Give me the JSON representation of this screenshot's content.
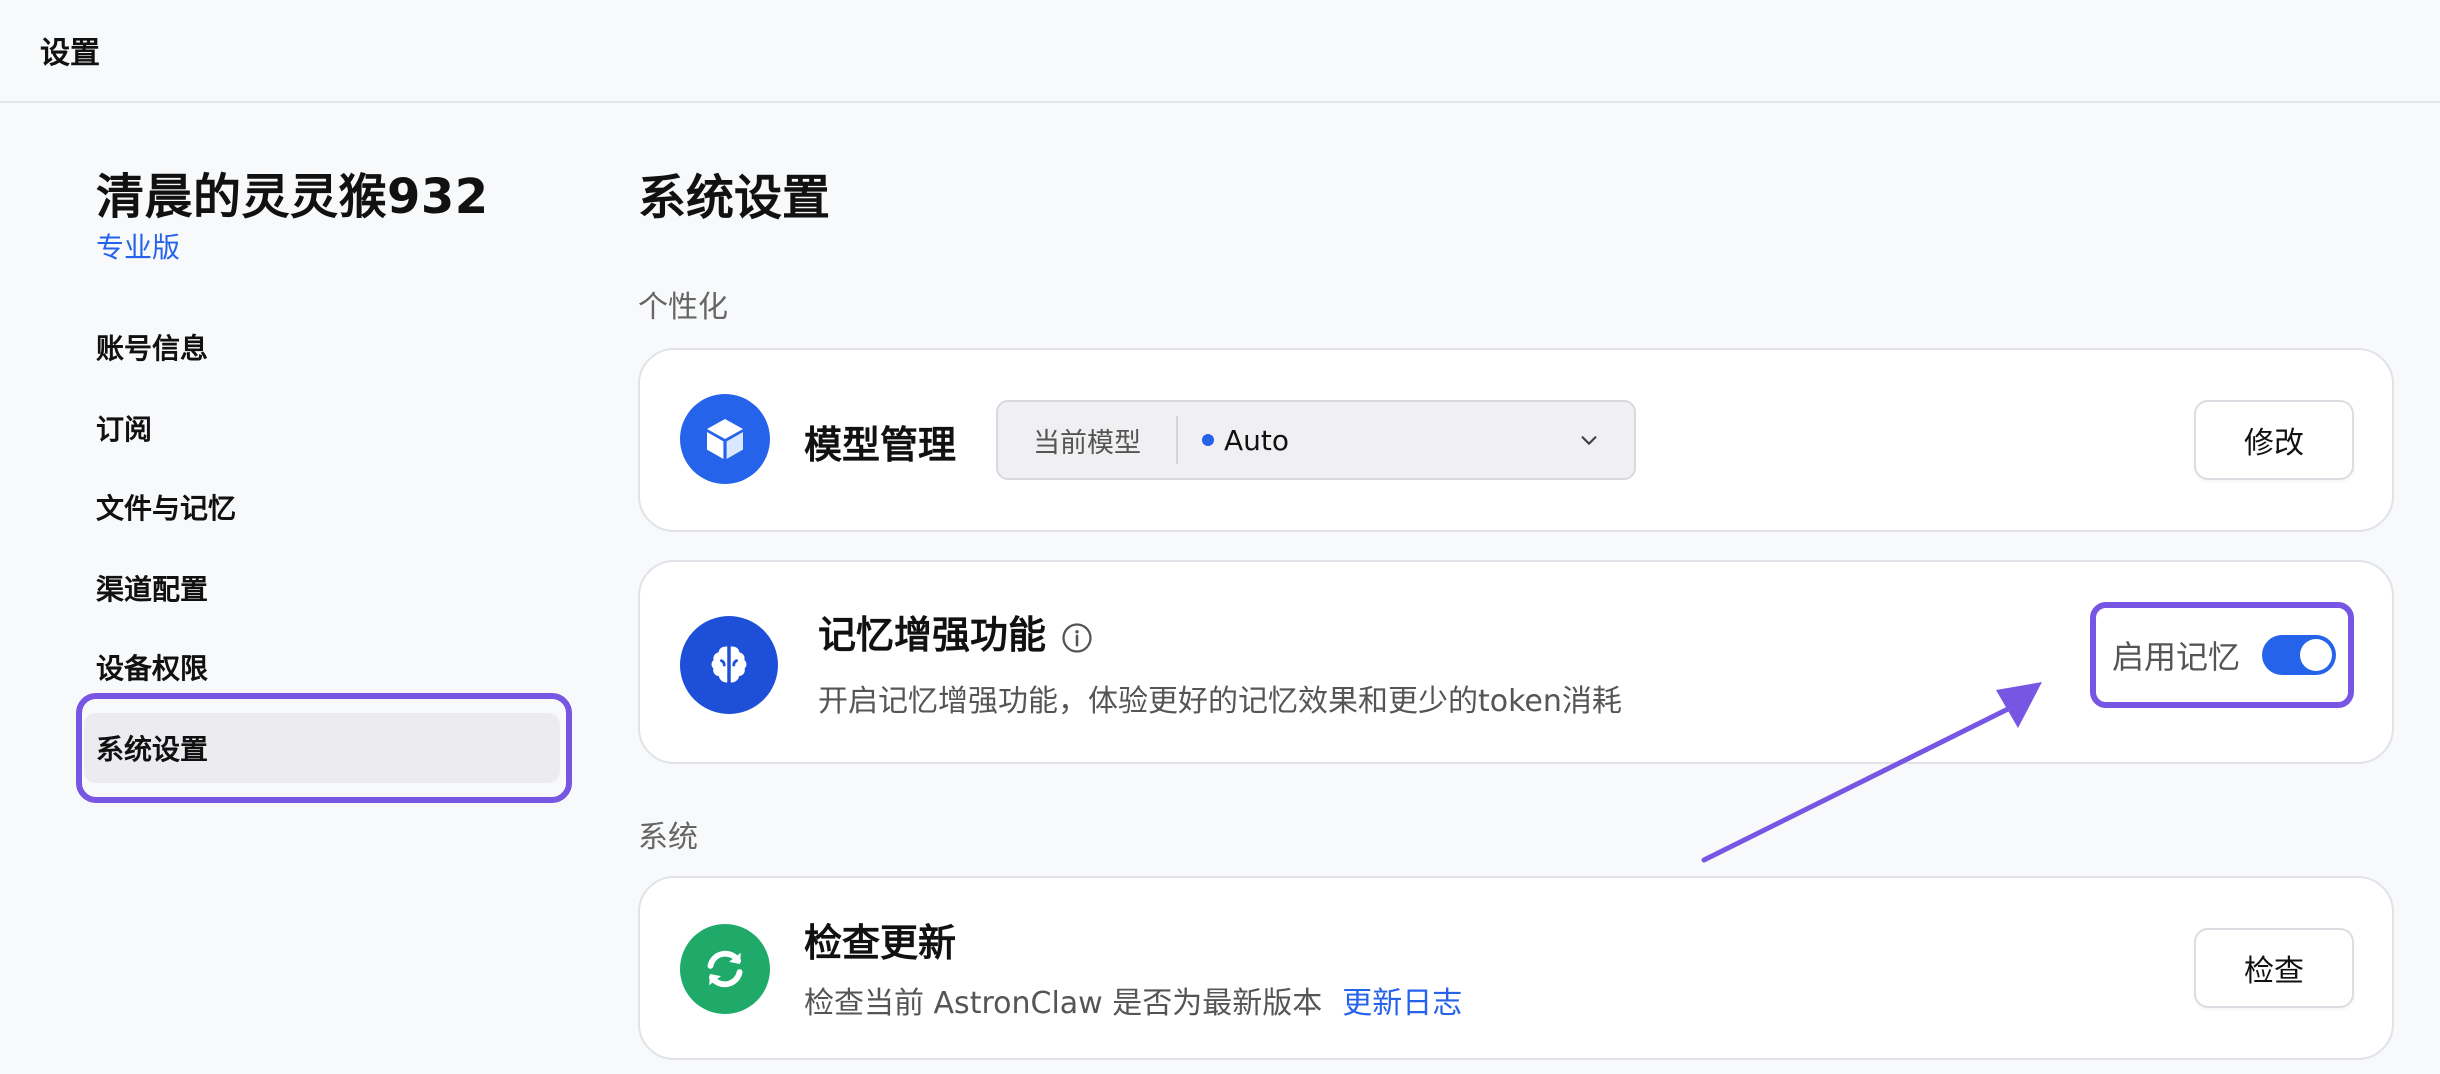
{
  "topbar": {
    "title": "设置"
  },
  "sidebar": {
    "user_name": "清晨的灵灵猴932",
    "plan": "专业版",
    "items": [
      {
        "label": "账号信息"
      },
      {
        "label": "订阅"
      },
      {
        "label": "文件与记忆"
      },
      {
        "label": "渠道配置"
      },
      {
        "label": "设备权限"
      },
      {
        "label": "系统设置"
      }
    ],
    "active_index": 5
  },
  "main": {
    "title": "系统设置",
    "section_personal": "个性化",
    "section_system": "系统",
    "model_card": {
      "title": "模型管理",
      "select_label": "当前模型",
      "select_value": "Auto",
      "button": "修改"
    },
    "memory_card": {
      "title": "记忆增强功能",
      "desc": "开启记忆增强功能，体验更好的记忆效果和更少的token消耗",
      "toggle_label": "启用记忆",
      "toggle_on": true
    },
    "update_card": {
      "title": "检查更新",
      "desc": "检查当前 AstronClaw 是否为最新版本",
      "link": "更新日志",
      "button": "检查"
    }
  },
  "colors": {
    "accent": "#2563eb",
    "highlight": "#7856e4",
    "update_icon": "#1faa6a",
    "model_icon": "#2563eb",
    "memory_icon": "#1d4fd8"
  },
  "icons": {
    "model": "cube-icon",
    "memory": "brain-icon",
    "update": "refresh-icon",
    "info": "info-icon",
    "dropdown": "chevron-down-icon"
  }
}
